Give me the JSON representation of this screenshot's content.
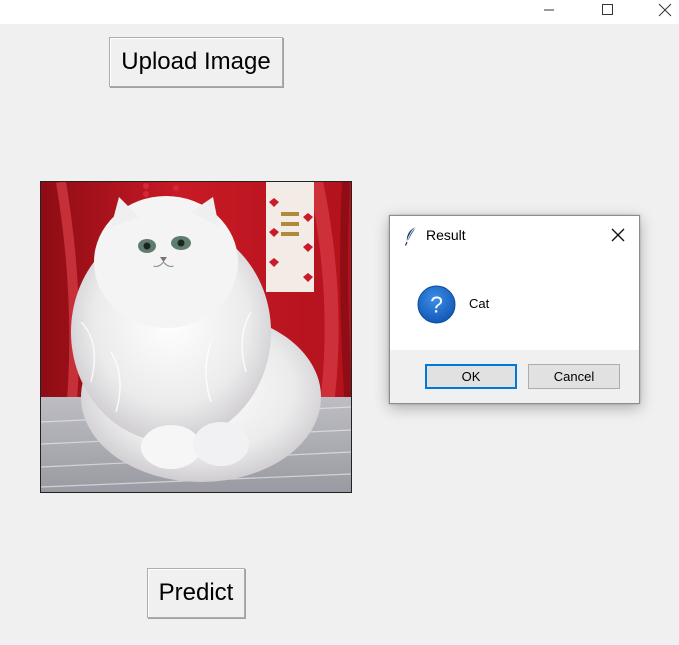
{
  "window": {
    "controls": {
      "minimize_icon": "minimize-icon",
      "maximize_icon": "maximize-icon",
      "close_icon": "close-icon"
    }
  },
  "main": {
    "upload_label": "Upload Image",
    "predict_label": "Predict",
    "image_alt": "cat photo"
  },
  "dialog": {
    "title": "Result",
    "icon": "question-icon",
    "message": "Cat",
    "ok_label": "OK",
    "cancel_label": "Cancel"
  },
  "colors": {
    "background": "#f0f0f0",
    "dialog_accent": "#0078d7",
    "question_icon": "#1e6fd0"
  }
}
